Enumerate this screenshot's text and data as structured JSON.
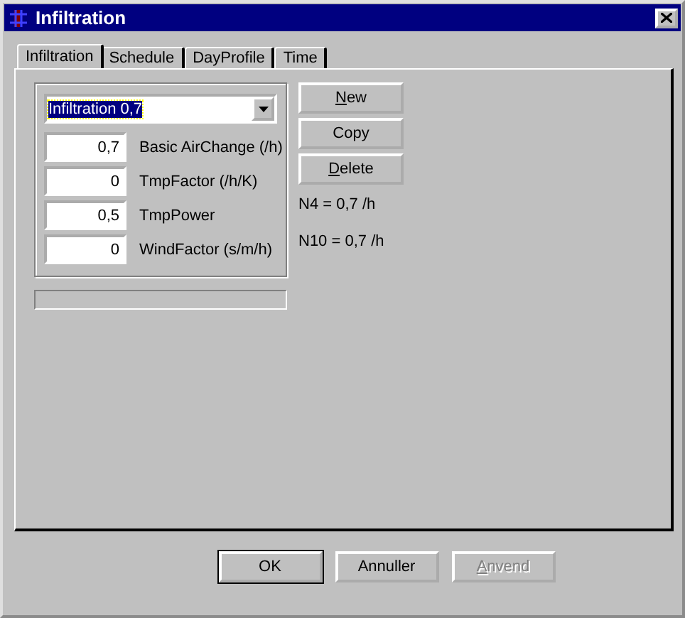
{
  "window": {
    "title": "Infiltration"
  },
  "tabs": [
    {
      "label": "Infiltration",
      "selected": true
    },
    {
      "label": "Schedule",
      "selected": false
    },
    {
      "label": "DayProfile",
      "selected": false
    },
    {
      "label": "Time",
      "selected": false
    }
  ],
  "selector": {
    "value": "Infiltration 0,7"
  },
  "fields": [
    {
      "value": "0,7",
      "label": "Basic AirChange (/h)"
    },
    {
      "value": "0",
      "label": "TmpFactor (/h/K)"
    },
    {
      "value": "0,5",
      "label": "TmpPower"
    },
    {
      "value": "0",
      "label": "WindFactor (s/m/h)"
    }
  ],
  "actions": [
    {
      "label": "New",
      "underline_first": true
    },
    {
      "label": "Copy",
      "underline_first": false
    },
    {
      "label": "Delete",
      "underline_first": true
    }
  ],
  "results": [
    "N4 = 0,7 /h",
    "N10 = 0,7 /h"
  ],
  "progress": {
    "level": 0
  },
  "buttons": [
    {
      "label": "OK",
      "default": true,
      "disabled": false,
      "underline_first": false
    },
    {
      "label": "Annuller",
      "default": false,
      "disabled": false,
      "underline_first": false
    },
    {
      "label": "Anvend",
      "default": false,
      "disabled": true,
      "underline_first": true
    }
  ]
}
